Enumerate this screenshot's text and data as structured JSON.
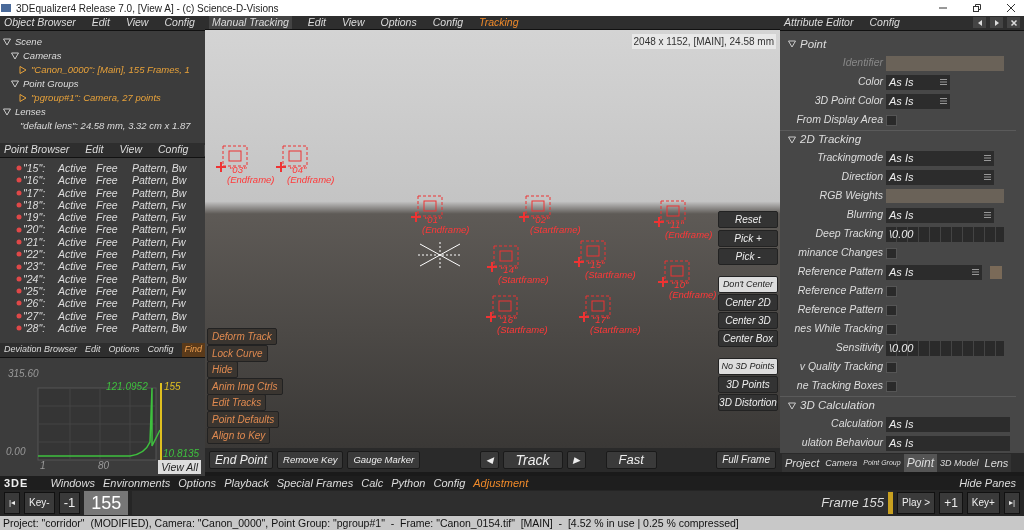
{
  "window": {
    "title": "3DEqualizer4 Release 7.0, [View A]  -  (c) Science-D-Visions"
  },
  "object_browser": {
    "title": "Object Browser",
    "menus": [
      "Edit",
      "View",
      "Config"
    ],
    "tree": [
      {
        "label": "Scene",
        "expanded": true,
        "highlighted": false,
        "children": [
          {
            "label": "Cameras",
            "expanded": true,
            "highlighted": false,
            "children": [
              {
                "label": "\"Canon_0000\": [Main], 155 Frames, 1",
                "expanded": false,
                "highlighted": true
              }
            ]
          },
          {
            "label": "Point Groups",
            "expanded": true,
            "highlighted": false,
            "children": [
              {
                "label": "\"pgroup#1\": Camera, 27 points",
                "expanded": false,
                "highlighted": true
              }
            ]
          }
        ]
      },
      {
        "label": "Lenses",
        "expanded": true,
        "highlighted": false,
        "children": [
          {
            "label": "\"default lens\": 24.58 mm, 3.32 cm x 1.87",
            "highlighted": false
          }
        ]
      }
    ]
  },
  "point_browser": {
    "title": "Point Browser",
    "menus": [
      "Edit",
      "View",
      "Config"
    ],
    "rows": [
      {
        "name": "\"15\":",
        "status": "Active",
        "mode": "Free",
        "type": "Pattern, Bw"
      },
      {
        "name": "\"16\":",
        "status": "Active",
        "mode": "Free",
        "type": "Pattern, Bw"
      },
      {
        "name": "\"17\":",
        "status": "Active",
        "mode": "Free",
        "type": "Pattern, Bw"
      },
      {
        "name": "\"18\":",
        "status": "Active",
        "mode": "Free",
        "type": "Pattern, Fw"
      },
      {
        "name": "\"19\":",
        "status": "Active",
        "mode": "Free",
        "type": "Pattern, Fw"
      },
      {
        "name": "\"20\":",
        "status": "Active",
        "mode": "Free",
        "type": "Pattern, Fw"
      },
      {
        "name": "\"21\":",
        "status": "Active",
        "mode": "Free",
        "type": "Pattern, Fw"
      },
      {
        "name": "\"22\":",
        "status": "Active",
        "mode": "Free",
        "type": "Pattern, Fw"
      },
      {
        "name": "\"23\":",
        "status": "Active",
        "mode": "Free",
        "type": "Pattern, Fw"
      },
      {
        "name": "\"24\":",
        "status": "Active",
        "mode": "Free",
        "type": "Pattern, Bw"
      },
      {
        "name": "\"25\":",
        "status": "Active",
        "mode": "Free",
        "type": "Pattern, Fw"
      },
      {
        "name": "\"26\":",
        "status": "Active",
        "mode": "Free",
        "type": "Pattern, Fw"
      },
      {
        "name": "\"27\":",
        "status": "Active",
        "mode": "Free",
        "type": "Pattern, Bw"
      },
      {
        "name": "\"28\":",
        "status": "Active",
        "mode": "Free",
        "type": "Pattern, Bw"
      }
    ]
  },
  "deviation_browser": {
    "title": "Deviation Browser",
    "menus": [
      {
        "label": "Edit",
        "selected": false
      },
      {
        "label": "Options",
        "selected": false
      },
      {
        "label": "Config",
        "selected": false
      },
      {
        "label": "Find",
        "selected": true
      }
    ],
    "y_max": "315.60",
    "y_min": "0.00",
    "x_start": "1",
    "x_mid": "80",
    "peak_value": "121.0952",
    "current_frame": "155",
    "end_value": "10.8135",
    "view_all": "View All"
  },
  "viewport": {
    "environment": "Manual Tracking",
    "menus": [
      {
        "label": "Edit",
        "selected": false
      },
      {
        "label": "View",
        "selected": false
      },
      {
        "label": "Options",
        "selected": false
      },
      {
        "label": "Config",
        "selected": false
      },
      {
        "label": "Tracking",
        "selected": true
      }
    ],
    "info": "2048 x 1152, [MAIN], 24.58 mm",
    "points": [
      {
        "label": "\"03\"",
        "note": "(Endframe)"
      },
      {
        "label": "\"04\"",
        "note": "(Endframe)"
      },
      {
        "label": "\"01\"",
        "note": "(Endframe)"
      },
      {
        "label": "\"02\"",
        "note": "(Startframe)"
      },
      {
        "label": "\"14\"",
        "note": "(Startframe)"
      },
      {
        "label": "\"15\"",
        "note": "(Startframe)"
      },
      {
        "label": "\"11\"",
        "note": "(Endframe)"
      },
      {
        "label": "\"10\"",
        "note": "(Endframe)"
      },
      {
        "label": "\"16\"",
        "note": "(Startframe)"
      },
      {
        "label": "\"17\"",
        "note": "(Startframe)"
      }
    ],
    "left_buttons": [
      "Deform Track",
      "Lock Curve",
      "Hide",
      "Anim Img Ctrls",
      "Edit Tracks",
      "Point Defaults",
      "Align to Key"
    ],
    "right_buttons": [
      {
        "label": "Reset",
        "selected": false
      },
      {
        "label": "Pick +",
        "selected": false
      },
      {
        "label": "Pick -",
        "selected": false
      },
      {
        "label": "Don't Center",
        "selected": true
      },
      {
        "label": "Center 2D",
        "selected": false
      },
      {
        "label": "Center 3D",
        "selected": false
      },
      {
        "label": "Center Box",
        "selected": false
      },
      {
        "label": "No 3D Points",
        "selected": true
      },
      {
        "label": "3D Points",
        "selected": false
      },
      {
        "label": "3D Distortion",
        "selected": false
      }
    ],
    "bottom_buttons": [
      "End Point",
      "Remove Key",
      "Gauge Marker"
    ],
    "track": {
      "prev": "◀",
      "label": "Track",
      "next": "▶"
    },
    "fast": "Fast",
    "full_frame": "Full Frame"
  },
  "attribute_editor": {
    "title": "Attribute Editor",
    "menus": [
      "Config"
    ],
    "rows": [
      {
        "kind": "section",
        "label": "Point"
      },
      {
        "kind": "text",
        "label": "Identifier",
        "disabled": true
      },
      {
        "kind": "dropdown",
        "label": "Color",
        "value": "As Is"
      },
      {
        "kind": "dropdown",
        "label": "3D Point Color",
        "value": "As Is"
      },
      {
        "kind": "checkbox",
        "label": "From Display Area",
        "checked": false
      },
      {
        "kind": "section",
        "label": "2D Tracking"
      },
      {
        "kind": "dropdown_wide",
        "label": "Trackingmode",
        "value": "As Is"
      },
      {
        "kind": "dropdown_wide",
        "label": "Direction",
        "value": "As Is"
      },
      {
        "kind": "swatch",
        "label": "RGB Weights"
      },
      {
        "kind": "dropdown_wide",
        "label": "Blurring",
        "value": "As Is"
      },
      {
        "kind": "slider",
        "label": "Deep Tracking",
        "value": "\\0.00"
      },
      {
        "kind": "checkbox",
        "label": "minance Changes",
        "checked": false
      },
      {
        "kind": "dropdown_color",
        "label": "Reference Pattern",
        "value": "As Is"
      },
      {
        "kind": "checkbox",
        "label": "Reference Pattern",
        "checked": false
      },
      {
        "kind": "checkbox",
        "label": "Reference Pattern",
        "checked": false
      },
      {
        "kind": "checkbox",
        "label": "nes While Tracking",
        "checked": false
      },
      {
        "kind": "slider",
        "label": "Sensitivity",
        "value": "\\0.00"
      },
      {
        "kind": "checkbox",
        "label": "v Quality Tracking",
        "checked": false
      },
      {
        "kind": "checkbox",
        "label": "ne Tracking Boxes",
        "checked": false
      },
      {
        "kind": "section",
        "label": "3D Calculation"
      },
      {
        "kind": "value",
        "label": "Calculation",
        "value": "As Is"
      },
      {
        "kind": "value",
        "label": "ulation Behaviour",
        "value": "As Is"
      }
    ],
    "tabs": [
      {
        "label": "Project",
        "selected": false
      },
      {
        "label": "Camera",
        "selected": false
      },
      {
        "label": "Point Group",
        "selected": false
      },
      {
        "label": "Point",
        "selected": true
      },
      {
        "label": "3D Model",
        "selected": false
      },
      {
        "label": "Lens",
        "selected": false
      }
    ]
  },
  "main_menu": {
    "logo": "3DE",
    "items": [
      {
        "label": "Windows",
        "selected": false
      },
      {
        "label": "Environments",
        "selected": false
      },
      {
        "label": "Options",
        "selected": false
      },
      {
        "label": "Playback",
        "selected": false
      },
      {
        "label": "Special Frames",
        "selected": false
      },
      {
        "label": "Calc",
        "selected": false
      },
      {
        "label": "Python",
        "selected": false
      },
      {
        "label": "Config",
        "selected": false
      },
      {
        "label": "Adjustment",
        "selected": true
      }
    ],
    "hide_panes": "Hide Panes"
  },
  "timeline": {
    "first": "|◂",
    "key_prev": "Key-",
    "step_back": "-1",
    "frame": "155",
    "frame_label": "Frame 155",
    "play": "Play >",
    "step_fwd": "+1",
    "key_next": "Key+",
    "last": "▸|"
  },
  "status_bar": "Project: \"corridor\"  (MODIFIED), Camera: \"Canon_0000\", Point Group: \"pgroup#1\"  -  Frame: \"Canon_0154.tif\"  [MAIN]  -  [4.52 % in use | 0.25 % compressed]"
}
